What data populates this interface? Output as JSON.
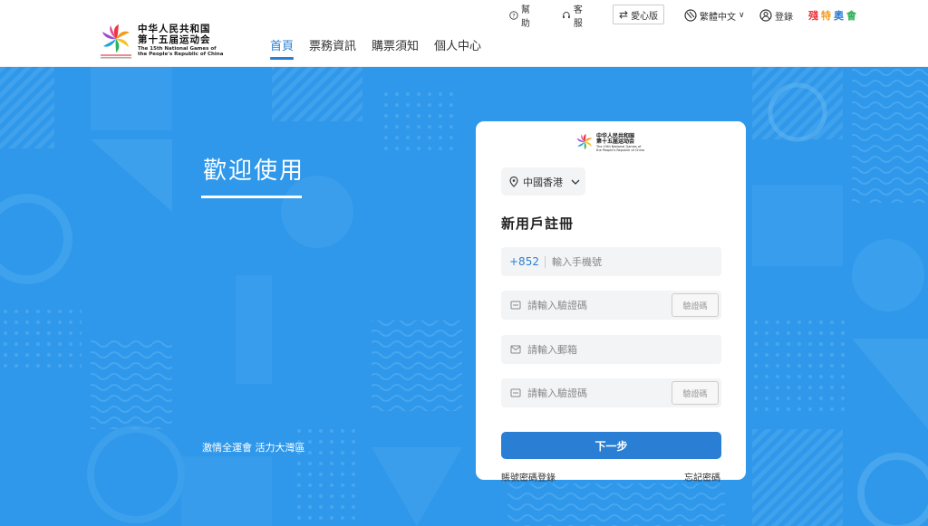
{
  "header": {
    "logo": {
      "cn_line1": "中华人民共和国",
      "cn_line2": "第十五届运动会",
      "en_line1": "The 15th National Games of",
      "en_line2": "the People's Republic of China"
    },
    "nav": [
      {
        "label": "首頁",
        "active": true
      },
      {
        "label": "票務資訊",
        "active": false
      },
      {
        "label": "購票須知",
        "active": false
      },
      {
        "label": "個人中心",
        "active": false
      }
    ],
    "topbar": {
      "help": "幫助",
      "service": "客服",
      "care": "愛心版",
      "language": "繁體中文",
      "login": "登錄",
      "paralympic": [
        "殘",
        "特",
        "奧",
        "會"
      ]
    }
  },
  "hero": {
    "welcome": "歡迎使用",
    "slogan": "激情全運會 活力大灣區"
  },
  "card": {
    "logo": {
      "cn_line1": "中华人民共和国",
      "cn_line2": "第十五届运动会",
      "en_line1": "The 15th National Games of",
      "en_line2": "the People's Republic of China"
    },
    "region": "中國香港",
    "title": "新用戶註冊",
    "phone_prefix": "+852",
    "phone_placeholder": "輸入手機號",
    "code_placeholder": "請輸入驗證碼",
    "code_button": "驗證碼",
    "email_placeholder": "請輸入郵箱",
    "next_button": "下一步",
    "password_login": "賬號密碼登錄",
    "forgot_password": "忘記密碼"
  },
  "colors": {
    "brand_blue": "#2a7fd4",
    "hero_blue": "#2f98ea",
    "paralympic": [
      "#e8383d",
      "#f29a1c",
      "#2a7fd4",
      "#2fb35a"
    ]
  }
}
